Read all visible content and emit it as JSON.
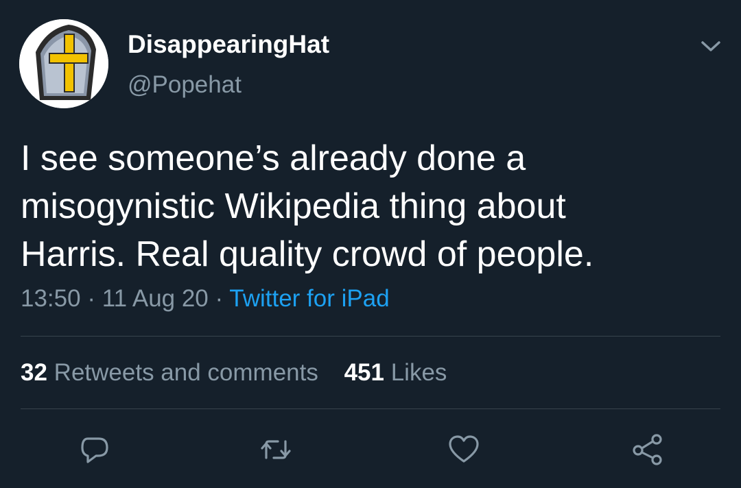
{
  "author": {
    "display_name": "DisappearingHat",
    "handle": "@Popehat",
    "avatar_icon": "mitre-cross-avatar"
  },
  "tweet": {
    "text": "I see someone’s already done a\nmisogynistic Wikipedia thing about\nHarris. Real quality crowd of people.",
    "time": "13:50",
    "separator": "·",
    "date": "11 Aug 20",
    "source": "Twitter for iPad"
  },
  "stats": {
    "retweets_count": "32",
    "retweets_label": "Retweets and comments",
    "likes_count": "451",
    "likes_label": "Likes"
  },
  "actions": [
    {
      "name": "reply",
      "icon": "speech-bubble-icon"
    },
    {
      "name": "retweet",
      "icon": "retweet-icon"
    },
    {
      "name": "like",
      "icon": "heart-icon"
    },
    {
      "name": "share",
      "icon": "share-icon"
    }
  ],
  "colors": {
    "background": "#15202b",
    "text_primary": "#ffffff",
    "text_secondary": "#8899a6",
    "link": "#1da1f2",
    "divider": "#38444d"
  }
}
